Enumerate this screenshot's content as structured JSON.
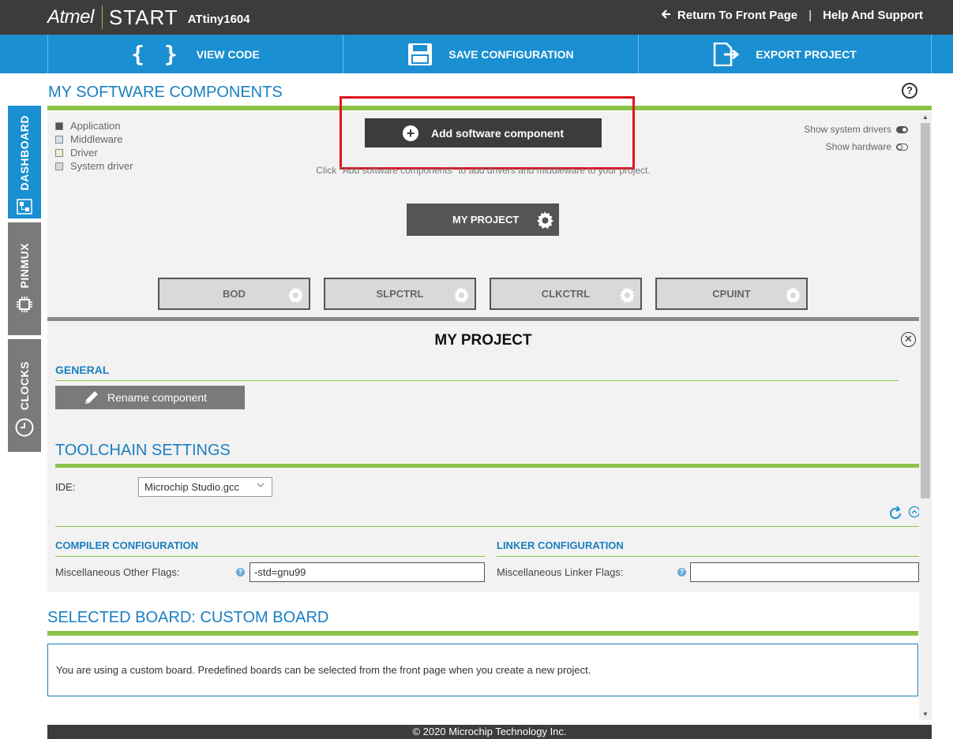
{
  "header": {
    "brand": "Atmel",
    "product": "START",
    "device": "ATtiny1604",
    "links": {
      "return": "Return To Front Page",
      "separator": "|",
      "help": "Help And Support"
    }
  },
  "toolbar": {
    "view_code": "VIEW CODE",
    "save_config": "SAVE CONFIGURATION",
    "export_project": "EXPORT PROJECT"
  },
  "sidebar": {
    "tabs": [
      {
        "label": "DASHBOARD",
        "active": true
      },
      {
        "label": "PINMUX",
        "active": false
      },
      {
        "label": "CLOCKS",
        "active": false
      }
    ]
  },
  "software_components": {
    "title": "MY SOFTWARE COMPONENTS",
    "help_glyph": "?",
    "legend": [
      {
        "label": "Application",
        "color": "#555555"
      },
      {
        "label": "Middleware",
        "color": "#cfe2f3"
      },
      {
        "label": "Driver",
        "color": "#efefd2"
      },
      {
        "label": "System driver",
        "color": "#d9d9d9"
      }
    ],
    "add_button": "Add software component",
    "hint": "Click \"Add software components\" to add drivers and middleware to your project.",
    "toggles": [
      {
        "label": "Show system drivers",
        "on": true
      },
      {
        "label": "Show hardware",
        "on": false
      }
    ],
    "project_node": "MY PROJECT",
    "components": [
      "BOD",
      "SLPCTRL",
      "CLKCTRL",
      "CPUINT"
    ]
  },
  "project_panel": {
    "title": "MY PROJECT",
    "close_glyph": "✕",
    "general_title": "GENERAL",
    "rename_button": "Rename component",
    "toolchain_title": "TOOLCHAIN SETTINGS",
    "ide_label": "IDE:",
    "ide_value": "Microchip Studio.gcc",
    "compiler_title": "COMPILER CONFIGURATION",
    "compiler_flags_label": "Miscellaneous Other Flags:",
    "compiler_flags_value": "-std=gnu99",
    "linker_title": "LINKER CONFIGURATION",
    "linker_flags_label": "Miscellaneous Linker Flags:",
    "linker_flags_value": "",
    "help_glyph": "?"
  },
  "board": {
    "title": "SELECTED BOARD: CUSTOM BOARD",
    "message": "You are using a custom board. Predefined boards can be selected from the front page when you create a new project."
  },
  "footer": {
    "copyright": "© 2020 Microchip Technology Inc."
  },
  "colors": {
    "accent_blue": "#1a8fd1",
    "accent_green": "#8bc34a",
    "highlight_red": "#e0141e",
    "header_dark": "#3c3c3c"
  }
}
